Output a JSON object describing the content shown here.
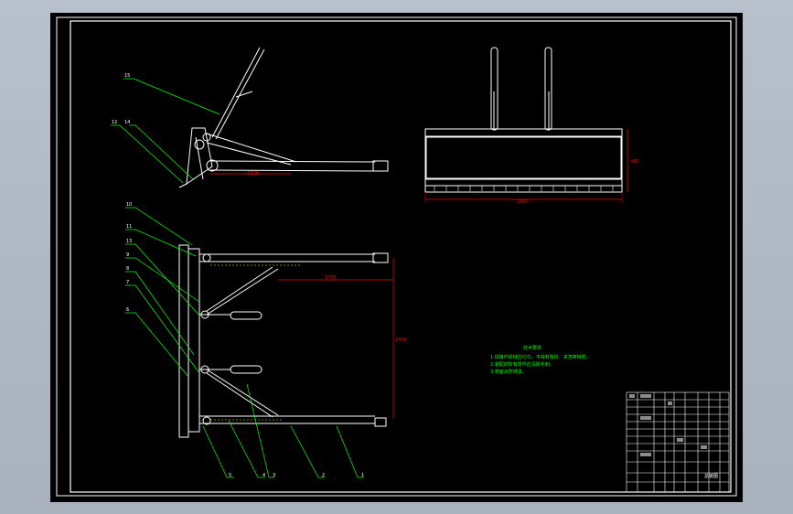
{
  "dimensions": {
    "side_length": "1500",
    "front_width": "2400",
    "front_height": "480",
    "plan_length": "1700",
    "plan_width": "2400"
  },
  "balloons": {
    "n1": "1",
    "n2": "2",
    "n3": "3",
    "n4": "4",
    "n5": "5",
    "n6": "6",
    "n7": "7",
    "n8": "8",
    "n9": "9",
    "n10": "10",
    "n11": "11",
    "n12": "12",
    "n13": "13",
    "n14": "14",
    "n15": "15"
  },
  "tech_notes": {
    "title": "技术要求",
    "lines": [
      "1.焊接件焊缝应均匀，不得有裂纹、夹渣等缺陷。",
      "2.装配前所有零件应清除毛刺。",
      "3.表面涂防锈漆。"
    ]
  },
  "title_block": {
    "sheet": "总装图"
  },
  "colors": {
    "line": "#ffffff",
    "dim": "#ff0000",
    "leader": "#00ff00",
    "hidden": "#ffff00",
    "bg": "#000000"
  }
}
